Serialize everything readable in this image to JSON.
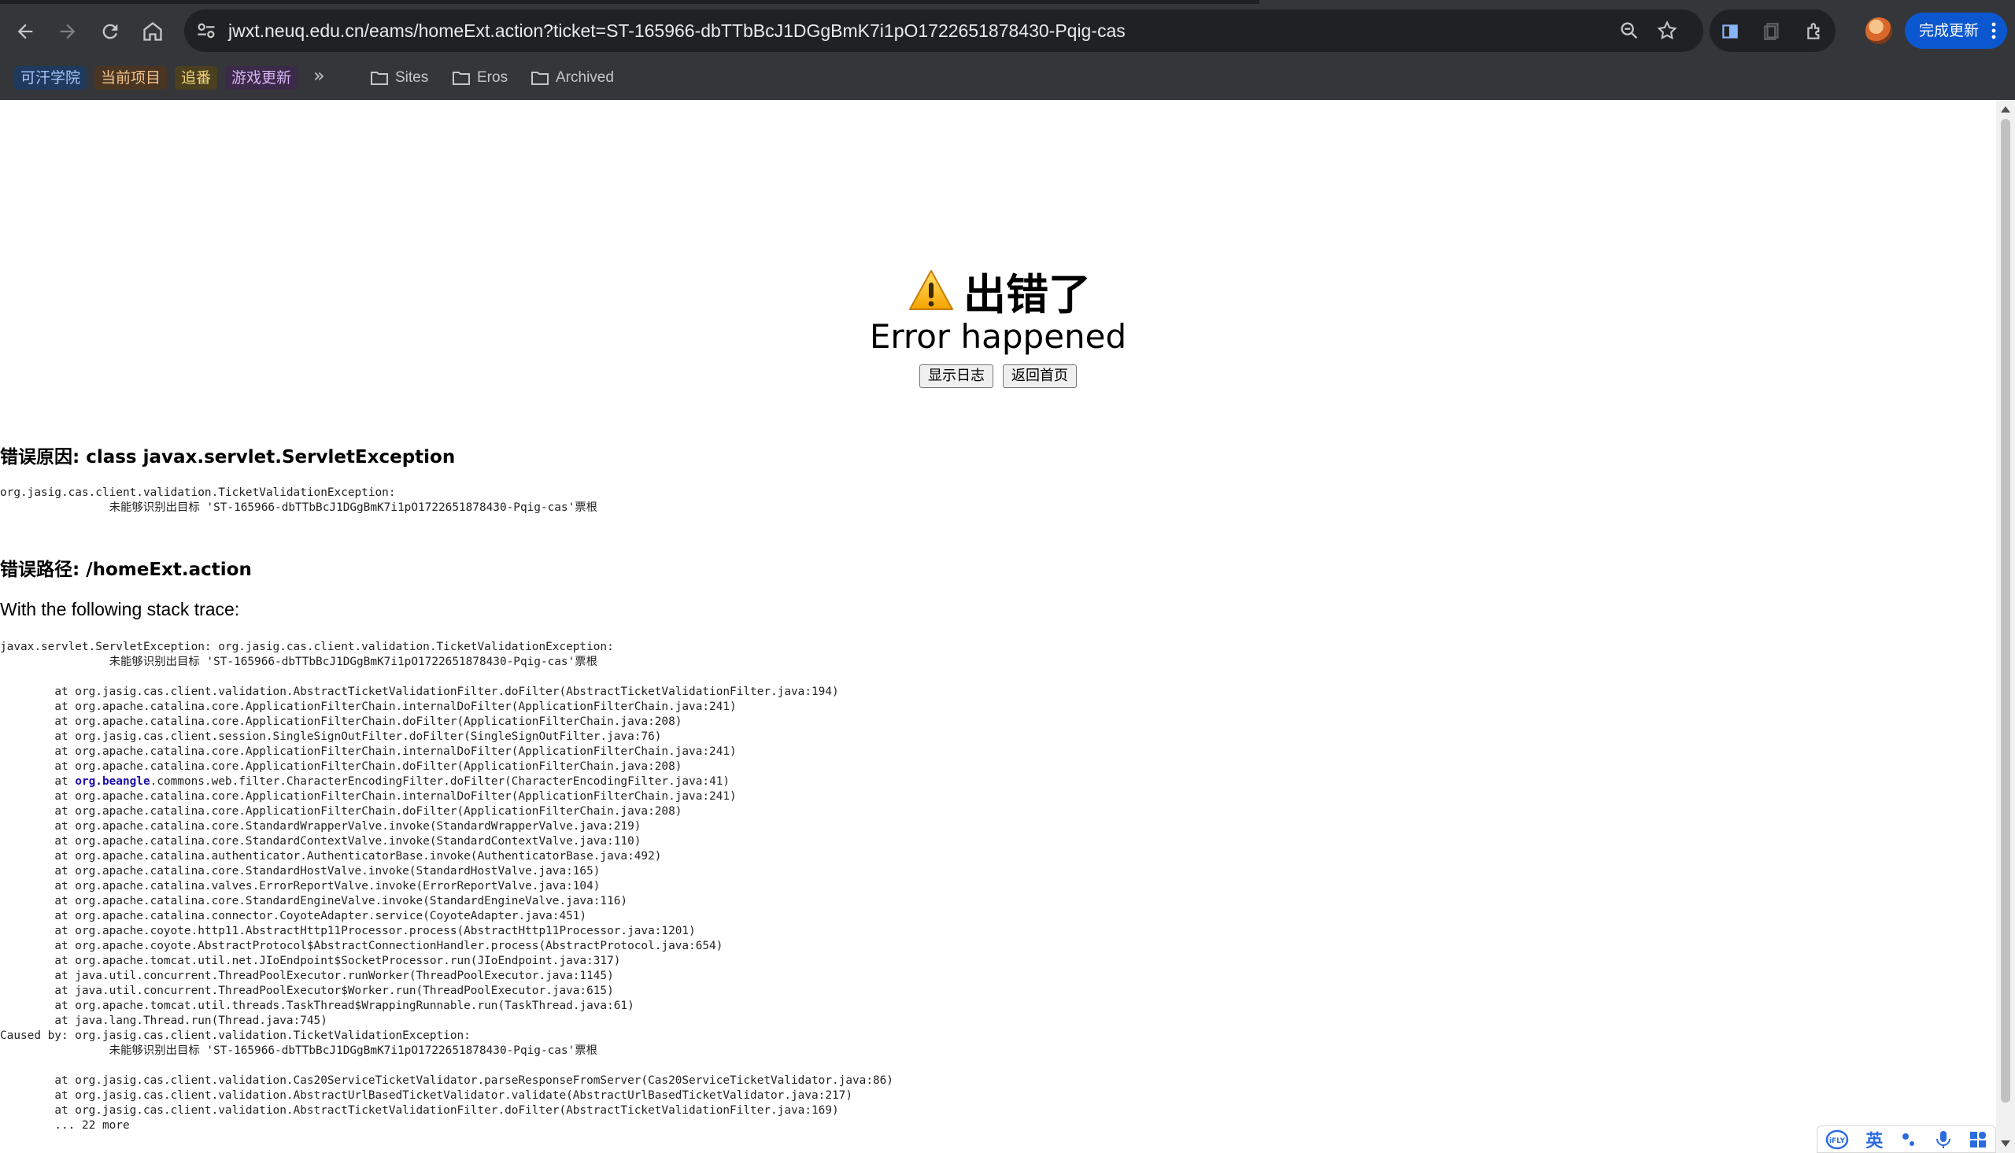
{
  "browser": {
    "url": "jwxt.neuq.edu.cn/eams/homeExt.action?ticket=ST-165966-dbTTbBcJ1DGgBmK7i1pO1722651878430-Pqig-cas",
    "update_label": "完成更新",
    "bookmarks": [
      {
        "label": "可汗学院",
        "bg": "#1f3a5f",
        "color": "#a8c7fa"
      },
      {
        "label": "当前项目",
        "bg": "#4a3523",
        "color": "#f2c48d"
      },
      {
        "label": "追番",
        "bg": "#4a3f1e",
        "color": "#f3d27a"
      },
      {
        "label": "游戏更新",
        "bg": "#3b2a4a",
        "color": "#d7b4f3"
      }
    ],
    "bookmark_folders": [
      "Sites",
      "Eros",
      "Archived"
    ]
  },
  "page": {
    "title_cn": "出错了",
    "title_en": "Error happened",
    "buttons": {
      "show_log": "显示日志",
      "go_home": "返回首页"
    },
    "cause_heading": "错误原因: class javax.servlet.ServletException",
    "cause_text": "org.jasig.cas.client.validation.TicketValidationException: \n\t\t未能够识别出目标 'ST-165966-dbTTbBcJ1DGgBmK7i1pO1722651878430-Pqig-cas'票根",
    "path_heading": "错误路径: /homeExt.action",
    "stack_intro": "With the following stack trace:",
    "stack_head": "javax.servlet.ServletException: org.jasig.cas.client.validation.TicketValidationException: \n\t\t未能够识别出目标 'ST-165966-dbTTbBcJ1DGgBmK7i1pO1722651878430-Pqig-cas'票根\n",
    "stack_lines_a": "\tat org.jasig.cas.client.validation.AbstractTicketValidationFilter.doFilter(AbstractTicketValidationFilter.java:194)\n\tat org.apache.catalina.core.ApplicationFilterChain.internalDoFilter(ApplicationFilterChain.java:241)\n\tat org.apache.catalina.core.ApplicationFilterChain.doFilter(ApplicationFilterChain.java:208)\n\tat org.jasig.cas.client.session.SingleSignOutFilter.doFilter(SingleSignOutFilter.java:76)\n\tat org.apache.catalina.core.ApplicationFilterChain.internalDoFilter(ApplicationFilterChain.java:241)\n\tat org.apache.catalina.core.ApplicationFilterChain.doFilter(ApplicationFilterChain.java:208)",
    "stack_beangle_prefix": "\tat ",
    "stack_beangle_link": "org.beangle",
    "stack_beangle_suffix": ".commons.web.filter.CharacterEncodingFilter.doFilter(CharacterEncodingFilter.java:41)",
    "stack_lines_b": "\tat org.apache.catalina.core.ApplicationFilterChain.internalDoFilter(ApplicationFilterChain.java:241)\n\tat org.apache.catalina.core.ApplicationFilterChain.doFilter(ApplicationFilterChain.java:208)\n\tat org.apache.catalina.core.StandardWrapperValve.invoke(StandardWrapperValve.java:219)\n\tat org.apache.catalina.core.StandardContextValve.invoke(StandardContextValve.java:110)\n\tat org.apache.catalina.authenticator.AuthenticatorBase.invoke(AuthenticatorBase.java:492)\n\tat org.apache.catalina.core.StandardHostValve.invoke(StandardHostValve.java:165)\n\tat org.apache.catalina.valves.ErrorReportValve.invoke(ErrorReportValve.java:104)\n\tat org.apache.catalina.core.StandardEngineValve.invoke(StandardEngineValve.java:116)\n\tat org.apache.catalina.connector.CoyoteAdapter.service(CoyoteAdapter.java:451)\n\tat org.apache.coyote.http11.AbstractHttp11Processor.process(AbstractHttp11Processor.java:1201)\n\tat org.apache.coyote.AbstractProtocol$AbstractConnectionHandler.process(AbstractProtocol.java:654)\n\tat org.apache.tomcat.util.net.JIoEndpoint$SocketProcessor.run(JIoEndpoint.java:317)\n\tat java.util.concurrent.ThreadPoolExecutor.runWorker(ThreadPoolExecutor.java:1145)\n\tat java.util.concurrent.ThreadPoolExecutor$Worker.run(ThreadPoolExecutor.java:615)\n\tat org.apache.tomcat.util.threads.TaskThread$WrappingRunnable.run(TaskThread.java:61)\n\tat java.lang.Thread.run(Thread.java:745)\nCaused by: org.jasig.cas.client.validation.TicketValidationException: \n\t\t未能够识别出目标 'ST-165966-dbTTbBcJ1DGgBmK7i1pO1722651878430-Pqig-cas'票根\n\n\tat org.jasig.cas.client.validation.Cas20ServiceTicketValidator.parseResponseFromServer(Cas20ServiceTicketValidator.java:86)\n\tat org.jasig.cas.client.validation.AbstractUrlBasedTicketValidator.validate(AbstractUrlBasedTicketValidator.java:217)\n\tat org.jasig.cas.client.validation.AbstractTicketValidationFilter.doFilter(AbstractTicketValidationFilter.java:169)\n\t... 22 more"
  },
  "ime": {
    "lang_label": "英"
  }
}
